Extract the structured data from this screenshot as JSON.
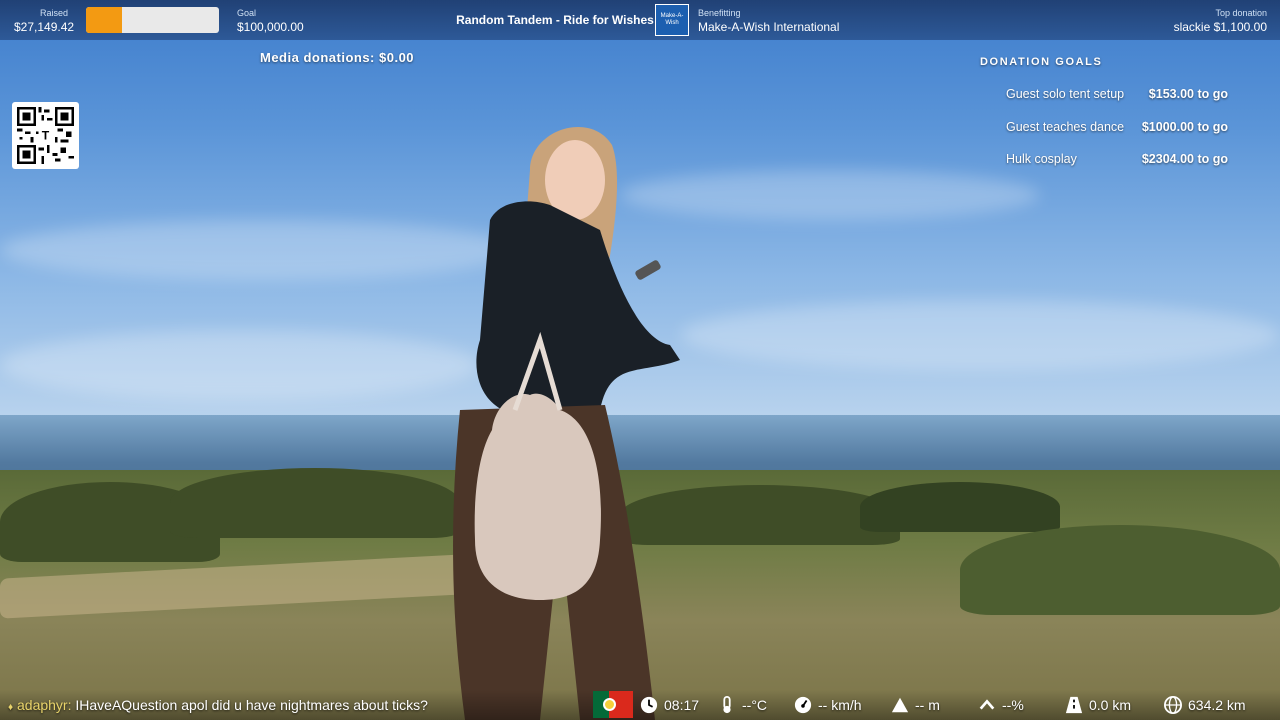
{
  "topbar": {
    "raised_label": "Raised",
    "raised_value": "$27,149.42",
    "progress_fraction": 0.27,
    "goal_label": "Goal",
    "goal_value": "$100,000.00",
    "title": "Random Tandem - Ride for Wishes",
    "logo_text": "Make-A-Wish",
    "benefitting_label": "Benefitting",
    "benefitting_value": "Make-A-Wish International",
    "top_donation_label": "Top donation",
    "top_donation_value": "slackie $1,100.00"
  },
  "media_donations": "Media donations: $0.00",
  "goals": {
    "title": "DONATION GOALS",
    "items": [
      {
        "name": "Guest solo tent setup",
        "amount": "$153.00 to go"
      },
      {
        "name": "Guest teaches dance",
        "amount": "$1000.00 to go"
      },
      {
        "name": "Hulk cosplay",
        "amount": "$2304.00 to go"
      }
    ]
  },
  "chat": {
    "user": "adaphyr:",
    "message": "IHaveAQuestion apol did u have nightmares about ticks?"
  },
  "stats": {
    "time": "08:17",
    "temperature": "--°C",
    "speed": "-- km/h",
    "altitude": "-- m",
    "incline": "--%",
    "distance": "0.0 km",
    "total_distance": "634.2 km"
  },
  "colors": {
    "progress_fill": "#f39a12",
    "chat_user": "#e8d36a",
    "flag_green": "#046a38",
    "flag_red": "#da291c"
  }
}
